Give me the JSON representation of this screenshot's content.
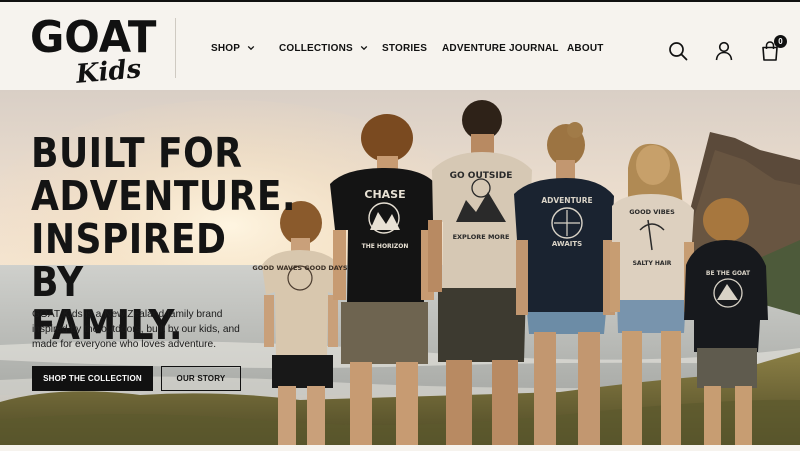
{
  "brand": {
    "logo_main": "GOAT",
    "logo_sub": "Kids"
  },
  "nav": {
    "items": [
      {
        "label": "SHOP",
        "has_dropdown": true
      },
      {
        "label": "COLLECTIONS",
        "has_dropdown": true
      },
      {
        "label": "STORIES",
        "has_dropdown": false
      },
      {
        "label": "ADVENTURE JOURNAL",
        "has_dropdown": false
      },
      {
        "label": "ABOUT",
        "has_dropdown": false
      }
    ]
  },
  "header_icons": {
    "search": "search-icon",
    "account": "user-icon",
    "cart": "shopping-bag-icon",
    "cart_count": "0"
  },
  "hero": {
    "headline_lines": [
      "BUILT FOR",
      "ADVENTURE.",
      "INSPIRED BY",
      "FAMILY."
    ],
    "subtext": "GOAT Kids is a New Zealand family brand inspired by the outdoors, built by our kids, and made for everyone who loves adventure.",
    "primary_cta": "SHOP THE COLLECTION",
    "secondary_cta": "OUR STORY",
    "tshirt_texts": {
      "child_left": "GOOD WAVES GOOD DAYS",
      "boy_chase_top": "CHASE",
      "boy_chase_bottom": "THE HORIZON",
      "dad_top": "GO OUTSIDE",
      "dad_bottom": "EXPLORE MORE",
      "mum_top": "ADVENTURE",
      "mum_bottom": "AWAITS",
      "girl_top": "GOOD VIBES",
      "girl_bottom": "SALTY HAIR",
      "child_right": "BE THE GOAT"
    }
  },
  "colors": {
    "header_bg": "#f6f3ee",
    "text": "#111111",
    "button_dark": "#111111"
  }
}
